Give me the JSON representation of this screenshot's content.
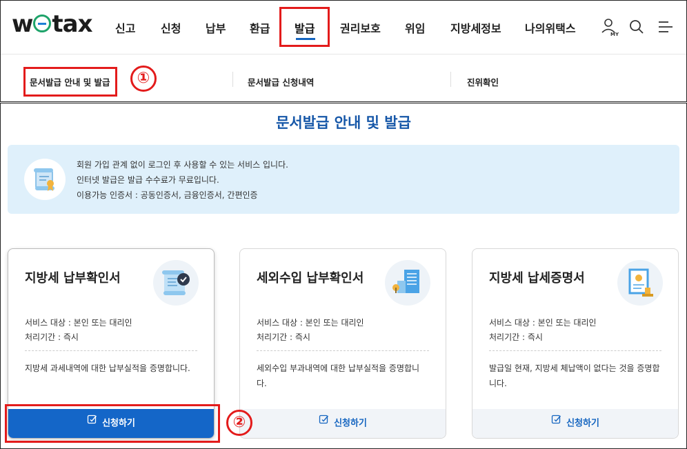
{
  "header": {
    "logo": {
      "pre": "w",
      "post": "tax"
    },
    "nav": [
      "신고",
      "신청",
      "납부",
      "환급",
      "발급",
      "권리보호",
      "위임",
      "지방세정보",
      "나의위택스"
    ],
    "active_nav": "발급",
    "icons": [
      "user-my-icon",
      "search-icon",
      "menu-icon"
    ],
    "my_label": "MY"
  },
  "subnav": {
    "items": [
      "문서발급 안내 및 발급",
      "문서발급 신청내역",
      "진위확인"
    ],
    "annotation": "①"
  },
  "main": {
    "title": "문서발급 안내 및 발급",
    "info": [
      "회원 가입 관계 없이 로그인 후 사용할 수 있는 서비스 입니다.",
      "인터넷 발급은 발급 수수료가 무료입니다.",
      "이용가능 인증서 : 공동인증서, 금융인증서, 간편인증"
    ],
    "cards": [
      {
        "title": "지방세 납부확인서",
        "target": "서비스 대상 : 본인 또는 대리인",
        "period": "처리기간 : 즉시",
        "desc": "지방세 과세내역에 대한 납부실적을 증명합니다.",
        "button": "신청하기"
      },
      {
        "title": "세외수입 납부확인서",
        "target": "서비스 대상 : 본인 또는 대리인",
        "period": "처리기간 : 즉시",
        "desc": "세외수입 부과내역에 대한 납부실적을 증명합니다.",
        "button": "신청하기"
      },
      {
        "title": "지방세 납세증명서",
        "target": "서비스 대상 : 본인 또는 대리인",
        "period": "처리기간 : 즉시",
        "desc": "발급일 현재, 지방세 체납액이 없다는 것을 증명합니다.",
        "button": "신청하기"
      }
    ],
    "annotation": "②"
  },
  "colors": {
    "accent": "#1466c8",
    "highlight": "#e31b1b",
    "title": "#1657a8",
    "info_bg": "#dff0fb"
  }
}
